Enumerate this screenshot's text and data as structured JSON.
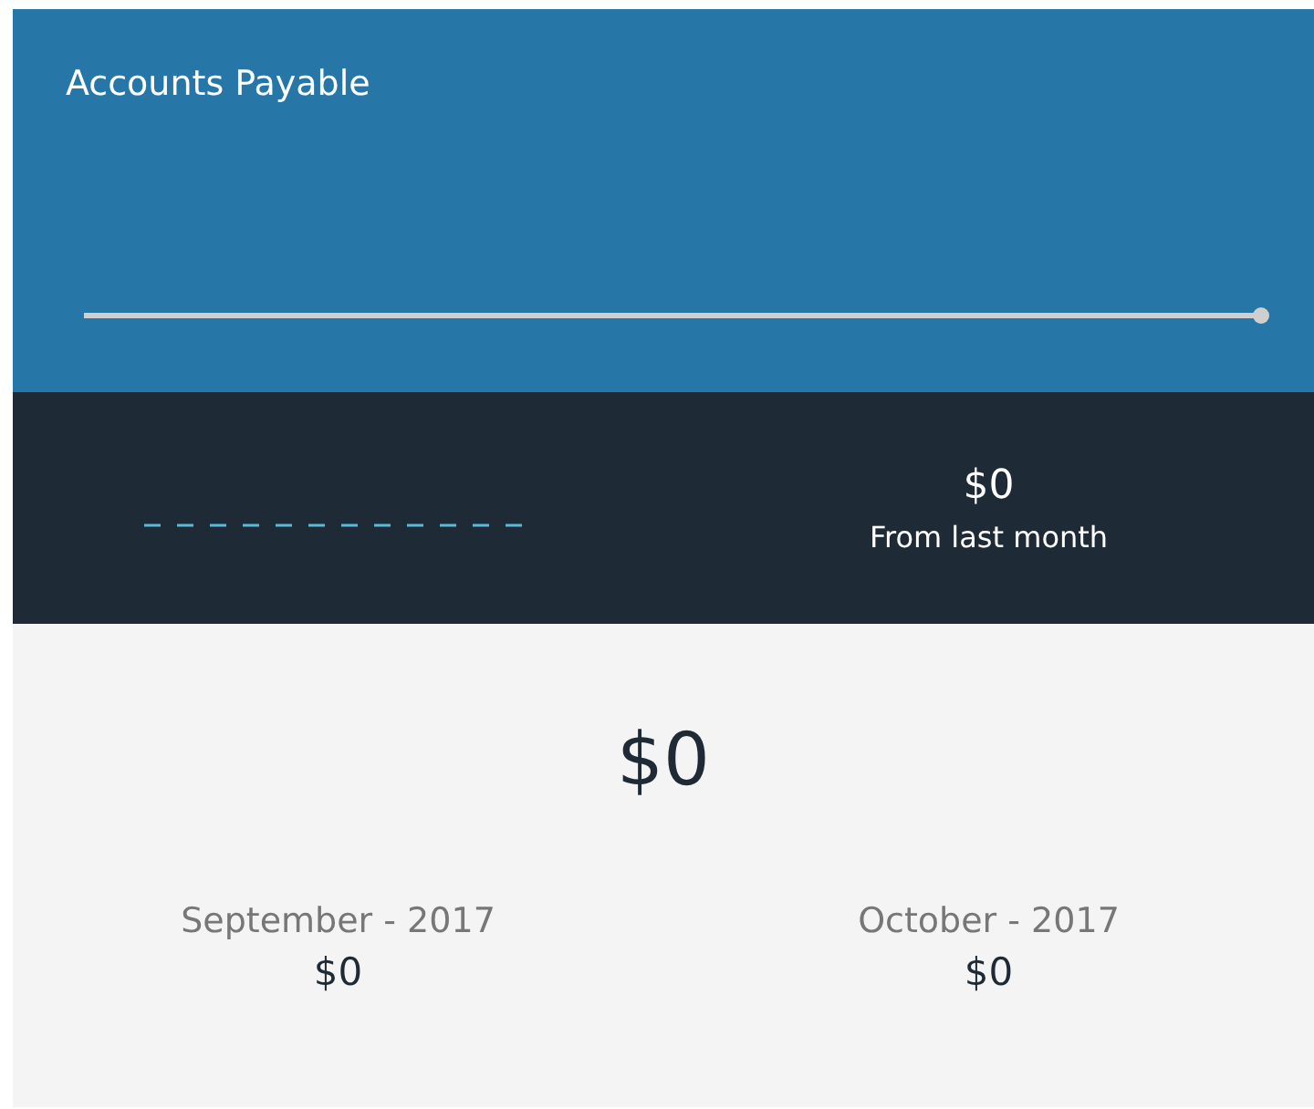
{
  "header": {
    "title": "Accounts Payable"
  },
  "summary": {
    "change": "$0",
    "change_label": "From last month"
  },
  "total": {
    "value": "$0"
  },
  "months": [
    {
      "label": "September - 2017",
      "value": "$0"
    },
    {
      "label": "October - 2017",
      "value": "$0"
    }
  ]
}
